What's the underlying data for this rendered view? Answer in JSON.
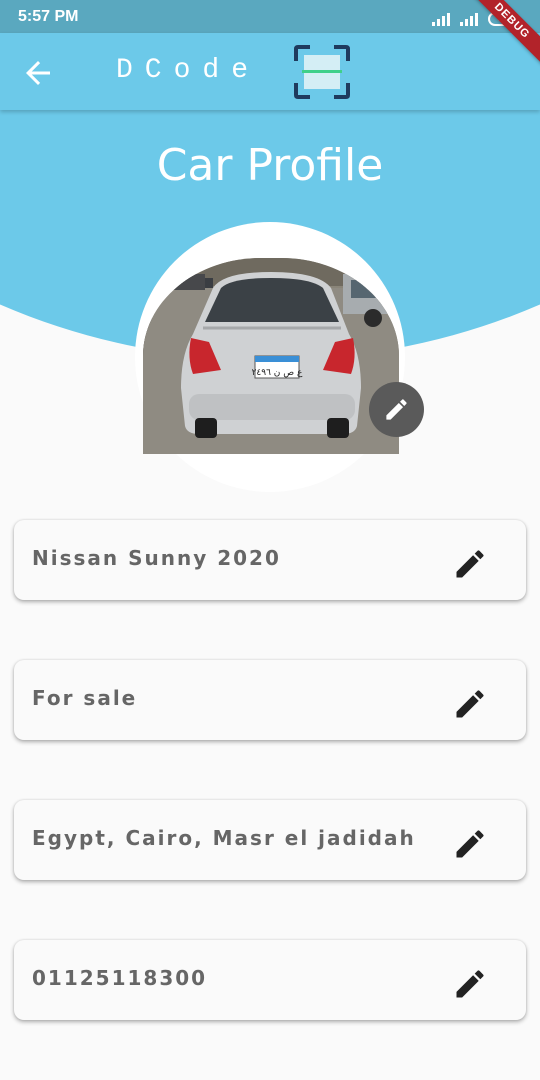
{
  "status_bar": {
    "time": "5:57 PM",
    "battery": "80"
  },
  "debug_banner": "DEBUG",
  "app_bar": {
    "brand": "DCode",
    "back_icon": "arrow-back-icon",
    "logo_icon": "barcode-scan-icon"
  },
  "page": {
    "title": "Car Profile"
  },
  "profile": {
    "photo_alt": "Car rear photo",
    "plate_text": "ع ص ن ٢٤٩٦",
    "edit_icon": "pencil-icon"
  },
  "fields": [
    {
      "value": "Nissan Sunny 2020",
      "edit_icon": "pencil-icon"
    },
    {
      "value": "For sale",
      "edit_icon": "pencil-icon"
    },
    {
      "value": "Egypt, Cairo, Masr el jadidah",
      "edit_icon": "pencil-icon"
    },
    {
      "value": "01125118300",
      "edit_icon": "pencil-icon"
    }
  ],
  "colors": {
    "primary": "#6cc9e9",
    "status_bar": "#5aa8bf",
    "background": "#fafafa",
    "text_secondary": "#666666",
    "icon_dark": "#222222",
    "fab": "#5a5a5a",
    "debug_ribbon": "#b2232a"
  }
}
